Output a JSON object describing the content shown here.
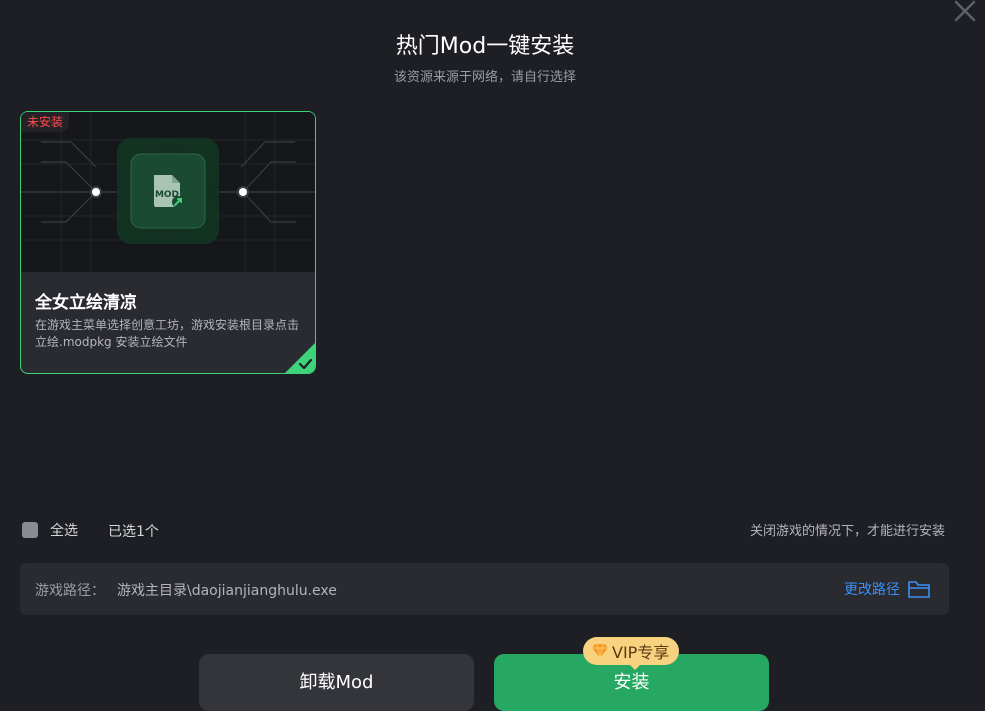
{
  "dialog": {
    "title": "热门Mod一键安装",
    "subtitle": "该资源来源于网络，请自行选择",
    "close_icon": "close-icon"
  },
  "mods": [
    {
      "status": "未安装",
      "icon": "mod-file-icon",
      "title": "全女立绘清凉",
      "description": "在游戏主菜单选择创意工坊，游戏安装根目录点击立绘.modpkg 安装立绘文件",
      "selected": true
    }
  ],
  "selection": {
    "select_all_label": "全选",
    "selected_count": "已选1个",
    "hint": "关闭游戏的情况下，才能进行安装"
  },
  "path": {
    "label": "游戏路径：",
    "value": "游戏主目录\\daojianjianghulu.exe",
    "change_label": "更改路径",
    "icon": "folder-icon"
  },
  "buttons": {
    "uninstall_label": "卸载Mod",
    "install_label": "安装",
    "vip_label": "VIP专享",
    "vip_icon": "diamond-icon"
  },
  "colors": {
    "background": "#1e1f24",
    "accent_green": "#27a862",
    "card_border": "#3ed27a",
    "link_blue": "#3b8ff5",
    "status_red": "#ff4d4f",
    "vip_gold": "#f9d280"
  }
}
